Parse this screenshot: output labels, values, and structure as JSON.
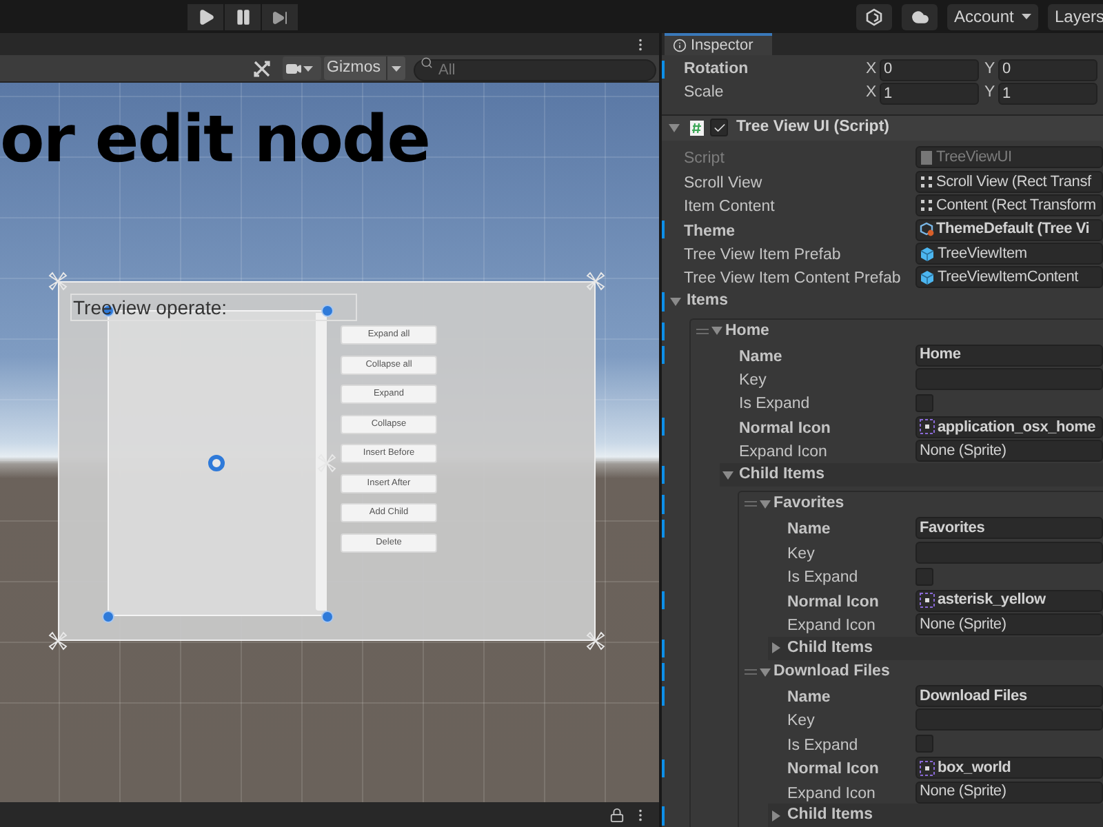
{
  "toolbar": {
    "play_controls": [
      {
        "kind": "play"
      },
      {
        "kind": "pause"
      },
      {
        "kind": "step"
      }
    ],
    "account": "Account",
    "layers": "Layers"
  },
  "scene": {
    "toolbar": {
      "gizmos": "Gizmos",
      "search": {
        "placeholder": "All"
      }
    },
    "heading": "or edit node",
    "canvas": {
      "title": "Treeview operate:",
      "buttons": [
        "Expand all",
        "Collapse all",
        "Expand",
        "Collapse",
        "Insert Before",
        "Insert After",
        "Add Child",
        "Delete"
      ]
    }
  },
  "inspector": {
    "tab": "Inspector",
    "transform": [
      {
        "label": "Rotation",
        "modified": true,
        "axes": [
          {
            "axis": "X",
            "value": "0"
          },
          {
            "axis": "Y",
            "value": "0"
          }
        ]
      },
      {
        "label": "Scale",
        "modified": false,
        "axes": [
          {
            "axis": "X",
            "value": "1"
          },
          {
            "axis": "Y",
            "value": "1"
          }
        ]
      }
    ],
    "component": {
      "title": "Tree View UI (Script)",
      "enabled": true,
      "expanded": true,
      "fields": [
        {
          "label": "Script",
          "kind": "script",
          "value": "TreeViewUI",
          "disabled": true,
          "modified": false
        },
        {
          "label": "Scroll View",
          "kind": "rect",
          "value": "Scroll View (Rect Transf",
          "disabled": false,
          "modified": false
        },
        {
          "label": "Item Content",
          "kind": "rect",
          "value": "Content (Rect Transform",
          "disabled": false,
          "modified": false
        },
        {
          "label": "Theme",
          "kind": "theme",
          "value": "ThemeDefault (Tree Vi",
          "disabled": false,
          "modified": true
        },
        {
          "label": "Tree View Item Prefab",
          "kind": "prefab",
          "value": "TreeViewItem",
          "disabled": false,
          "modified": false
        },
        {
          "label": "Tree View Item Content Prefab",
          "kind": "prefab",
          "value": "TreeViewItemContent",
          "disabled": false,
          "modified": false
        }
      ]
    },
    "items": {
      "label": "Items",
      "expanded": true,
      "modified": true,
      "children": [
        {
          "label": "Home",
          "expanded": true,
          "modified": true,
          "fields": [
            {
              "label": "Name",
              "kind": "text",
              "value": "Home",
              "modified": true
            },
            {
              "label": "Key",
              "kind": "text",
              "modified": false
            },
            {
              "label": "Is Expand",
              "kind": "checkbox",
              "checked": false,
              "modified": false
            },
            {
              "label": "Normal Icon",
              "kind": "sprite",
              "value": "application_osx_home",
              "modified": true
            },
            {
              "label": "Expand Icon",
              "kind": "none",
              "value": "None (Sprite)",
              "modified": false
            }
          ],
          "child_items": {
            "label": "Child Items",
            "expanded": true,
            "modified": true,
            "children": [
              {
                "label": "Favorites",
                "expanded": true,
                "modified": true,
                "fields": [
                  {
                    "label": "Name",
                    "kind": "text",
                    "value": "Favorites",
                    "modified": true
                  },
                  {
                    "label": "Key",
                    "kind": "text",
                    "modified": false
                  },
                  {
                    "label": "Is Expand",
                    "kind": "checkbox",
                    "checked": false,
                    "modified": false
                  },
                  {
                    "label": "Normal Icon",
                    "kind": "sprite",
                    "value": "asterisk_yellow",
                    "modified": true
                  },
                  {
                    "label": "Expand Icon",
                    "kind": "none",
                    "value": "None (Sprite)",
                    "modified": false
                  }
                ],
                "child_items": {
                  "label": "Child Items",
                  "expanded": false,
                  "modified": true
                }
              },
              {
                "label": "Download Files",
                "expanded": true,
                "modified": true,
                "fields": [
                  {
                    "label": "Name",
                    "kind": "text",
                    "value": "Download Files",
                    "modified": true
                  },
                  {
                    "label": "Key",
                    "kind": "text",
                    "modified": false
                  },
                  {
                    "label": "Is Expand",
                    "kind": "checkbox",
                    "checked": false,
                    "modified": false
                  },
                  {
                    "label": "Normal Icon",
                    "kind": "sprite",
                    "value": "box_world",
                    "modified": true
                  },
                  {
                    "label": "Expand Icon",
                    "kind": "none",
                    "value": "None (Sprite)",
                    "modified": false
                  }
                ],
                "child_items": {
                  "label": "Child Items",
                  "expanded": false,
                  "modified": true
                }
              }
            ]
          }
        }
      ]
    }
  }
}
